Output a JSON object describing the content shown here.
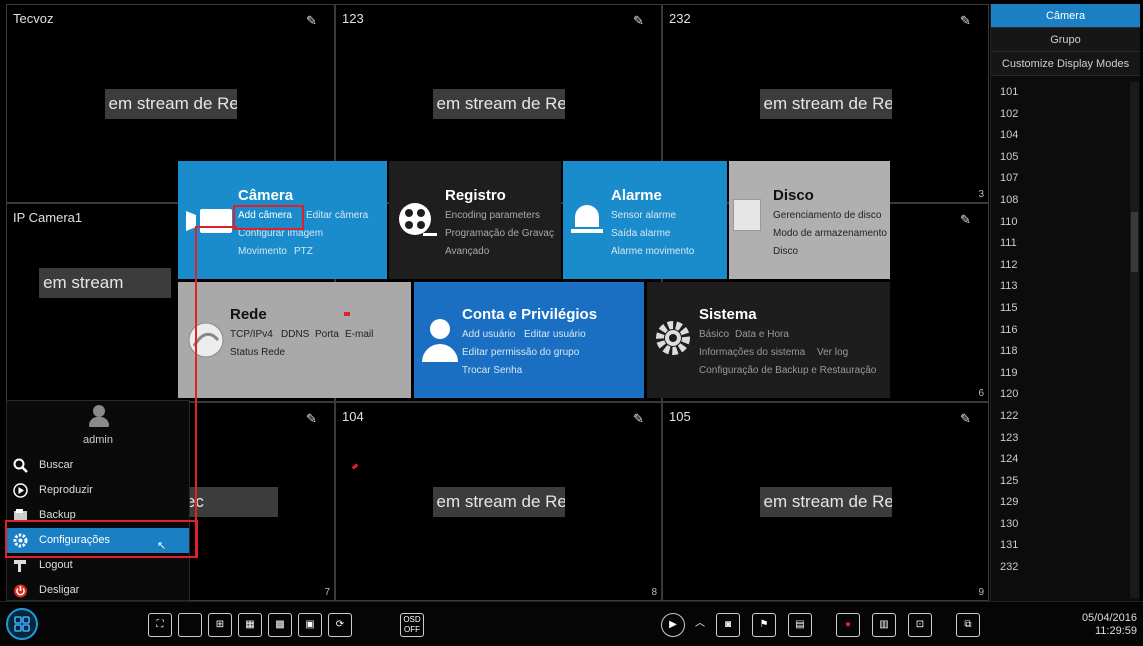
{
  "channels": [
    {
      "name": "Tecvoz",
      "status": "em stream de Rec",
      "index": ""
    },
    {
      "name": "123",
      "status": "em stream de Rec",
      "index": ""
    },
    {
      "name": "232",
      "status": "em stream de Rec",
      "index": "3"
    },
    {
      "name": "IP Camera1",
      "status": "em stream",
      "index": ""
    },
    {
      "name": "",
      "status": "",
      "index": ""
    },
    {
      "name": "",
      "status": "",
      "index": "6"
    },
    {
      "name": "",
      "status": "de Rec",
      "index": "7"
    },
    {
      "name": "104",
      "status": "em stream de Rec",
      "index": "8"
    },
    {
      "name": "105",
      "status": "em stream de Rec",
      "index": "9"
    }
  ],
  "right_panel": {
    "tabs": [
      "Câmera",
      "Grupo",
      "Customize Display Modes"
    ],
    "cameras": [
      "101",
      "102",
      "104",
      "105",
      "107",
      "108",
      "110",
      "111",
      "112",
      "113",
      "115",
      "116",
      "118",
      "119",
      "120",
      "122",
      "123",
      "124",
      "125",
      "129",
      "130",
      "131",
      "232"
    ]
  },
  "menu": {
    "camera": {
      "title": "Câmera",
      "add": "Add câmera",
      "edit": "Editar câmera",
      "image": "Configurar imagem",
      "motion": "Movimento",
      "ptz": "PTZ"
    },
    "registro": {
      "title": "Registro",
      "l1": "Encoding parameters",
      "l2": "Programação de Gravaç",
      "l3": "Avançado"
    },
    "alarme": {
      "title": "Alarme",
      "l1": "Sensor alarme",
      "l2": "Saída alarme",
      "l3": "Alarme movimento"
    },
    "disco": {
      "title": "Disco",
      "l1": "Gerenciamento de disco",
      "l2": "Modo de armazenamento",
      "l3": "Disco"
    },
    "rede": {
      "title": "Rede",
      "l1a": "TCP/IPv4",
      "l1b": "DDNS",
      "l1c": "Porta",
      "l1d": "E-mail",
      "l2": "Status Rede"
    },
    "conta": {
      "title": "Conta e Privilégios",
      "l1a": "Add usuário",
      "l1b": "Editar usuário",
      "l2": "Editar permissão do grupo",
      "l3": "Trocar Senha"
    },
    "sistema": {
      "title": "Sistema",
      "l1a": "Básico",
      "l1b": "Data e Hora",
      "l2a": "Informações do sistema",
      "l2b": "Ver log",
      "l3": "Configuração de Backup e Restauração"
    }
  },
  "left_menu": {
    "user": "admin",
    "items": [
      "Buscar",
      "Reproduzir",
      "Backup",
      "Configurações",
      "Logout",
      "Desligar"
    ]
  },
  "bottom": {
    "osd1": "OSD",
    "osd2": "OFF",
    "date": "05/04/2016",
    "time": "11:29:59"
  },
  "colors": {
    "accent": "#1b7fc4",
    "highlight": "#e0212b"
  }
}
